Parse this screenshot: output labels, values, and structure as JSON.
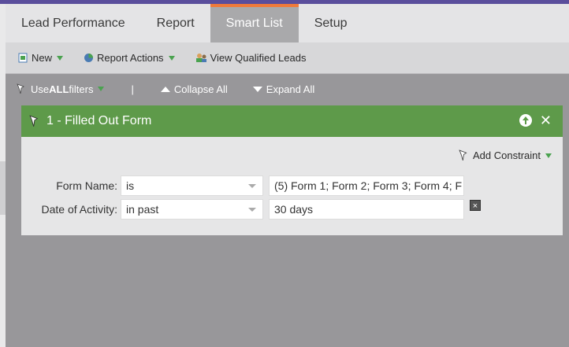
{
  "tabs": [
    {
      "label": "Lead Performance"
    },
    {
      "label": "Report"
    },
    {
      "label": "Smart List"
    },
    {
      "label": "Setup"
    }
  ],
  "toolbar": {
    "new_label": "New",
    "report_actions_label": "Report Actions",
    "view_qualified_label": "View Qualified Leads"
  },
  "filterbar": {
    "use_prefix": "Use ",
    "use_all": "ALL",
    "use_suffix": " filters",
    "separator": "|",
    "collapse_label": "Collapse All",
    "expand_label": "Expand All"
  },
  "filter": {
    "title": "1 - Filled Out Form",
    "add_constraint": "Add Constraint",
    "rows": [
      {
        "label": "Form Name:",
        "operator": "is",
        "value": "(5) Form 1; Form 2; Form 3; Form 4; F"
      },
      {
        "label": "Date of Activity:",
        "operator": "in past",
        "value": "30 days"
      }
    ],
    "delete_glyph": "×"
  },
  "colors": {
    "accent_tab": "#f07a3a",
    "filter_header": "#5e9a4a",
    "top_bar": "#5a4e9c"
  }
}
